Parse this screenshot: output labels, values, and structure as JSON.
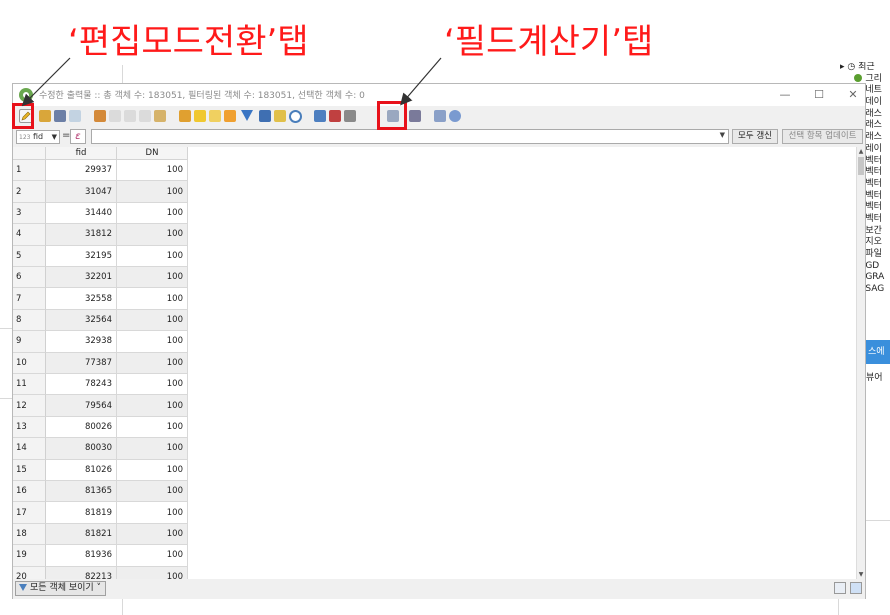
{
  "annotations": {
    "edit_tab": "‘편집모드전환’탭",
    "calc_tab": "‘필드계산기’탭"
  },
  "window": {
    "title": "수정한 출력물 :: 총 객체 수: 183051, 필터링된 객체 수: 183051, 선택한 객체 수: 0",
    "minimize": "—",
    "maximize": "☐",
    "close": "✕"
  },
  "filter_bar": {
    "field_selector": "fid",
    "field_type_tag": "123",
    "equals": "=",
    "expression_icon": "ε",
    "update_all": "모두 갱신",
    "update_selected": "선택 항목 업데이트"
  },
  "table": {
    "columns": [
      "fid",
      "DN"
    ],
    "rows": [
      {
        "n": "1",
        "fid": "29937",
        "dn": "100"
      },
      {
        "n": "2",
        "fid": "31047",
        "dn": "100"
      },
      {
        "n": "3",
        "fid": "31440",
        "dn": "100"
      },
      {
        "n": "4",
        "fid": "31812",
        "dn": "100"
      },
      {
        "n": "5",
        "fid": "32195",
        "dn": "100"
      },
      {
        "n": "6",
        "fid": "32201",
        "dn": "100"
      },
      {
        "n": "7",
        "fid": "32558",
        "dn": "100"
      },
      {
        "n": "8",
        "fid": "32564",
        "dn": "100"
      },
      {
        "n": "9",
        "fid": "32938",
        "dn": "100"
      },
      {
        "n": "10",
        "fid": "77387",
        "dn": "100"
      },
      {
        "n": "11",
        "fid": "78243",
        "dn": "100"
      },
      {
        "n": "12",
        "fid": "79564",
        "dn": "100"
      },
      {
        "n": "13",
        "fid": "80026",
        "dn": "100"
      },
      {
        "n": "14",
        "fid": "80030",
        "dn": "100"
      },
      {
        "n": "15",
        "fid": "81026",
        "dn": "100"
      },
      {
        "n": "16",
        "fid": "81365",
        "dn": "100"
      },
      {
        "n": "17",
        "fid": "81819",
        "dn": "100"
      },
      {
        "n": "18",
        "fid": "81821",
        "dn": "100"
      },
      {
        "n": "19",
        "fid": "81936",
        "dn": "100"
      },
      {
        "n": "20",
        "fid": "82213",
        "dn": "100"
      }
    ]
  },
  "status": {
    "show_all": "모든 객체 보이기"
  },
  "background_panel": {
    "items": [
      "최근",
      "그리",
      "네트",
      "데이",
      "래스",
      "래스",
      "래스",
      "레이",
      "벡터",
      "벡터",
      "벡터",
      "벡터",
      "벡터",
      "벡터",
      "보간",
      "지오",
      "파일",
      "GD",
      "GRA",
      "SAG"
    ],
    "selected": "스에 다",
    "viewer": "뷰어"
  },
  "colors": {
    "annotation": "#e8111a",
    "qgis_green": "#6aa84f",
    "selection_blue": "#3a8fdc"
  }
}
